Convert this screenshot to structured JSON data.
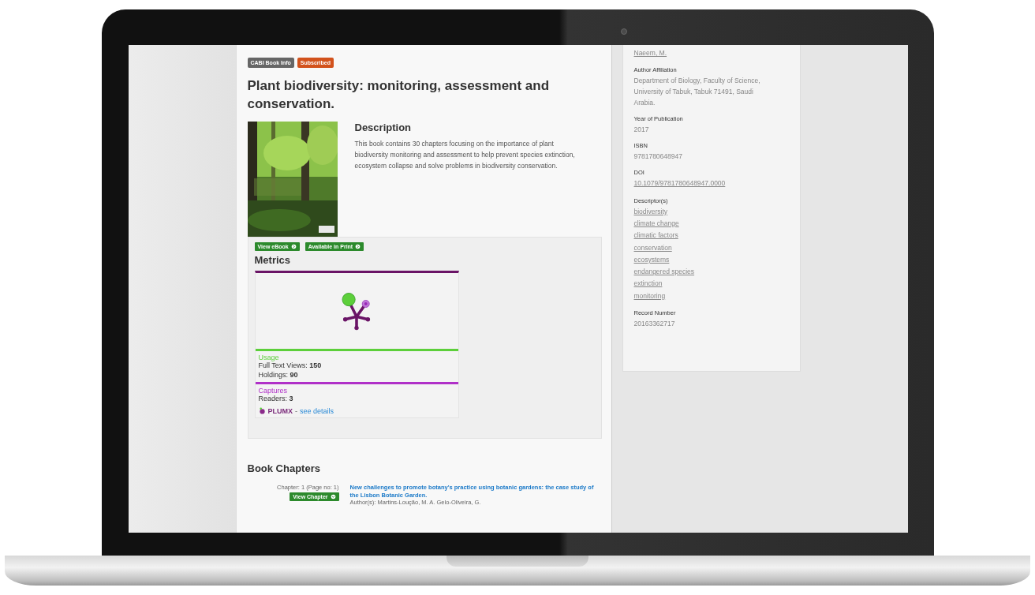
{
  "badges": [
    {
      "label": "CABI Book Info",
      "kind": "info"
    },
    {
      "label": "Subscribed",
      "kind": "subscribed"
    }
  ],
  "title": "Plant biodiversity: monitoring, assessment and conservation.",
  "description": {
    "heading": "Description",
    "text": "This book contains 30 chapters focusing on the importance of plant biodiversity monitoring and assessment to help prevent species extinction, ecosystem collapse and solve problems in biodiversity conservation."
  },
  "actions": [
    "View eBook",
    "Available in Print"
  ],
  "metrics": {
    "heading": "Metrics",
    "sections": [
      {
        "kind": "usage",
        "heading": "Usage",
        "lines": [
          {
            "label": "Full Text Views:",
            "value": "150"
          },
          {
            "label": "Holdings:",
            "value": "90"
          }
        ]
      },
      {
        "kind": "captures",
        "heading": "Captures",
        "lines": [
          {
            "label": "Readers:",
            "value": "3"
          }
        ]
      }
    ],
    "logo": "PLUMX",
    "separator": "-",
    "link": "see details"
  },
  "chapters": {
    "heading": "Book Chapters",
    "items": [
      {
        "number": "Chapter: 1 (Page no: 1)",
        "button": "View Chapter",
        "title": "New challenges to promote botany's practice using botanic gardens: the case study of the Lisbon Botanic Garden.",
        "authors": "Author(s): Martins-Loução, M. A. Gelo-Oliveira, G."
      }
    ]
  },
  "sidebar": {
    "fields": [
      {
        "link": true,
        "values": [
          "Naeem, M."
        ]
      },
      {
        "label": "Author Affiliation",
        "link": false,
        "values": [
          "Department of Biology, Faculty of Science, University of Tabuk, Tabuk 71491, Saudi Arabia."
        ]
      },
      {
        "label": "Year of Publication",
        "link": false,
        "values": [
          "2017"
        ]
      },
      {
        "label": "ISBN",
        "link": false,
        "values": [
          "9781780648947"
        ]
      },
      {
        "label": "DOI",
        "link": true,
        "values": [
          "10.1079/9781780648947.0000"
        ]
      },
      {
        "label": "Descriptor(s)",
        "link": true,
        "values": [
          "biodiversity",
          "climate change",
          "climatic factors",
          "conservation",
          "ecosystems",
          "endangered species",
          "extinction",
          "monitoring"
        ]
      },
      {
        "label": "Record Number",
        "link": false,
        "values": [
          "20163362717"
        ]
      }
    ]
  }
}
